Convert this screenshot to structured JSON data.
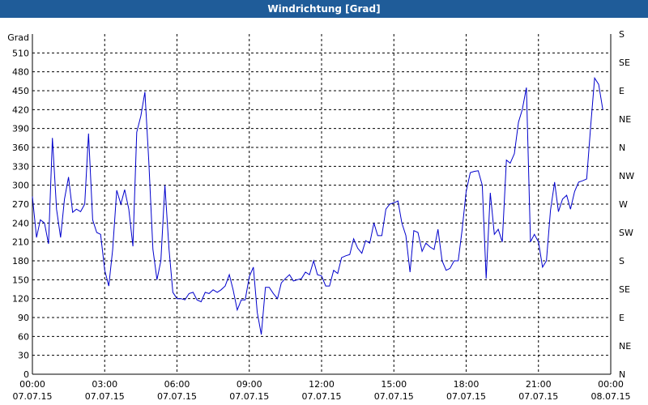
{
  "window": {
    "title": "Windrichtung [Grad]"
  },
  "chart_data": {
    "type": "line",
    "title": "Windrichtung [Grad]",
    "ylabel": "Grad",
    "ylim": [
      0,
      540
    ],
    "y_ticks": [
      0,
      30,
      60,
      90,
      120,
      150,
      180,
      210,
      240,
      270,
      300,
      330,
      360,
      390,
      420,
      450,
      480,
      510
    ],
    "right_ticks": [
      {
        "value": 0,
        "label": "N"
      },
      {
        "value": 45,
        "label": "NE"
      },
      {
        "value": 90,
        "label": "E"
      },
      {
        "value": 135,
        "label": "SE"
      },
      {
        "value": 180,
        "label": "S"
      },
      {
        "value": 225,
        "label": "SW"
      },
      {
        "value": 270,
        "label": "W"
      },
      {
        "value": 315,
        "label": "NW"
      },
      {
        "value": 360,
        "label": "N"
      },
      {
        "value": 405,
        "label": "NE"
      },
      {
        "value": 450,
        "label": "E"
      },
      {
        "value": 495,
        "label": "SE"
      },
      {
        "value": 540,
        "label": "S"
      }
    ],
    "x_ticks": [
      {
        "time": "00:00",
        "date": "07.07.15"
      },
      {
        "time": "03:00",
        "date": "07.07.15"
      },
      {
        "time": "06:00",
        "date": "07.07.15"
      },
      {
        "time": "09:00",
        "date": "07.07.15"
      },
      {
        "time": "12:00",
        "date": "07.07.15"
      },
      {
        "time": "15:00",
        "date": "07.07.15"
      },
      {
        "time": "18:00",
        "date": "07.07.15"
      },
      {
        "time": "21:00",
        "date": "07.07.15"
      },
      {
        "time": "00:00",
        "date": "08.07.15"
      }
    ],
    "xlim_hours": [
      0,
      24
    ],
    "grid": true,
    "line_color": "#0000cc",
    "series": [
      {
        "x_hours": [
          0,
          0.17,
          0.33,
          0.5,
          0.67,
          0.83,
          1,
          1.17,
          1.33,
          1.5,
          1.67,
          1.83,
          2,
          2.17,
          2.33,
          2.5,
          2.67,
          2.83,
          3,
          3.17,
          3.33,
          3.5,
          3.67,
          3.83,
          4,
          4.17,
          4.33,
          4.5,
          4.67,
          4.83,
          5,
          5.17,
          5.33,
          5.5,
          5.67,
          5.83,
          6,
          6.17,
          6.33,
          6.5,
          6.67,
          6.83,
          7,
          7.17,
          7.33,
          7.5,
          7.67,
          7.83,
          8,
          8.17,
          8.33,
          8.5,
          8.67,
          8.83,
          9,
          9.17,
          9.33,
          9.5,
          9.67,
          9.83,
          10,
          10.17,
          10.33,
          10.5,
          10.67,
          10.83,
          11,
          11.17,
          11.33,
          11.5,
          11.67,
          11.83,
          12,
          12.17,
          12.33,
          12.5,
          12.67,
          12.83,
          13,
          13.17,
          13.33,
          13.5,
          13.67,
          13.83,
          14,
          14.17,
          14.33,
          14.5,
          14.67,
          14.83,
          15,
          15.17,
          15.33,
          15.5,
          15.67,
          15.83,
          16,
          16.17,
          16.33,
          16.5,
          16.67,
          16.83,
          17,
          17.17,
          17.33,
          17.5,
          17.67,
          17.83,
          18,
          18.17,
          18.33,
          18.5,
          18.67,
          18.83,
          19,
          19.17,
          19.33,
          19.5,
          19.67,
          19.83,
          20,
          20.17,
          20.33,
          20.5,
          20.67,
          20.83,
          21,
          21.17,
          21.33,
          21.5,
          21.67,
          21.83,
          22,
          22.17,
          22.33,
          22.5,
          22.67,
          22.83,
          23,
          23.17,
          23.33,
          23.5,
          23.67,
          23.83,
          24
        ],
        "values": [
          282,
          217,
          245,
          240,
          207,
          375,
          262,
          217,
          278,
          313,
          257,
          262,
          258,
          270,
          382,
          245,
          225,
          222,
          165,
          140,
          198,
          292,
          270,
          293,
          262,
          203,
          384,
          410,
          448,
          338,
          198,
          150,
          180,
          300,
          198,
          130,
          120,
          120,
          118,
          128,
          130,
          118,
          115,
          130,
          128,
          134,
          130,
          134,
          140,
          158,
          134,
          102,
          118,
          118,
          155,
          170,
          98,
          63,
          138,
          138,
          128,
          120,
          145,
          152,
          158,
          148,
          150,
          152,
          162,
          158,
          180,
          158,
          156,
          140,
          140,
          165,
          160,
          185,
          188,
          190,
          215,
          200,
          192,
          212,
          208,
          240,
          220,
          220,
          262,
          270,
          272,
          275,
          240,
          220,
          162,
          228,
          225,
          195,
          208,
          202,
          198,
          230,
          180,
          165,
          168,
          180,
          180,
          228,
          290,
          320,
          322,
          323,
          300,
          152,
          288,
          222,
          230,
          210,
          340,
          335,
          350,
          400,
          420,
          455,
          210,
          222,
          210,
          170,
          180,
          260,
          305,
          258,
          278,
          284,
          262,
          290,
          305,
          307,
          310,
          395,
          470,
          460,
          420
        ]
      }
    ]
  }
}
